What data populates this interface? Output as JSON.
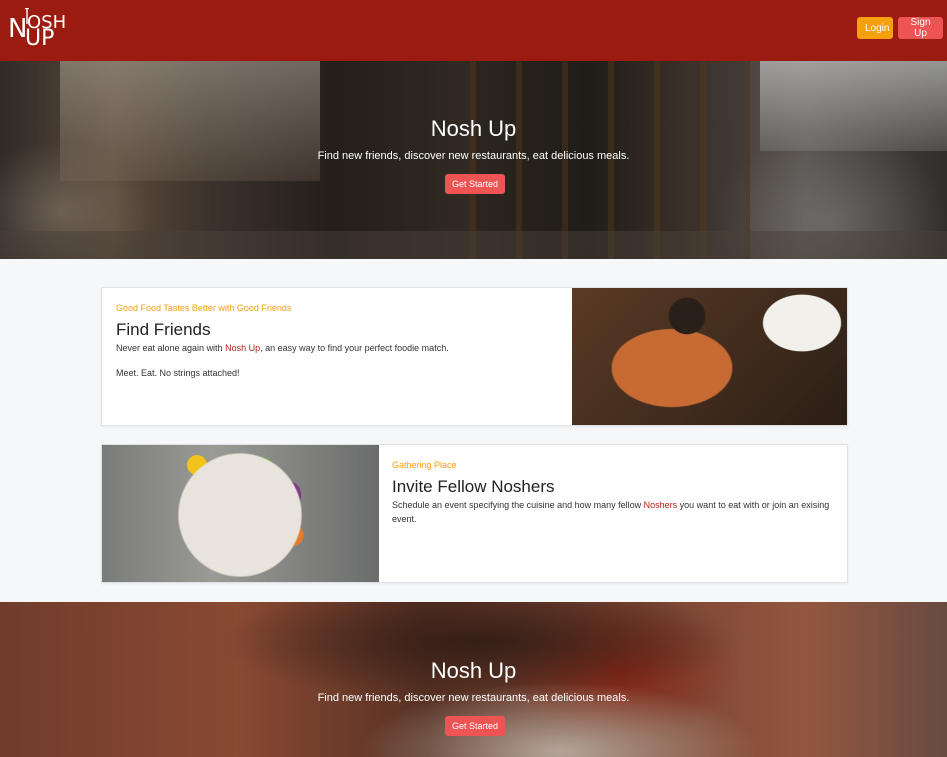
{
  "navbar": {
    "logo": {
      "n": "N",
      "osh": "OSH",
      "up": "UP"
    },
    "login_label": "Login",
    "signup_label": "Sign Up"
  },
  "hero_top": {
    "title": "Nosh Up",
    "subtitle": "Find new friends, discover new restaurants, eat delicious meals.",
    "button_label": "Get Started"
  },
  "feature_find_friends": {
    "eyebrow": "Good Food Tastes Better with Good Friends",
    "title": "Find Friends",
    "body_before": "Never eat alone again with ",
    "body_brand": "Nosh Up",
    "body_after": ", an easy way to find your perfect foodie match.",
    "tagline": "Meet. Eat. No strings attached!"
  },
  "feature_invite": {
    "eyebrow": "Gathering Place",
    "title": "Invite Fellow Noshers",
    "body_before": "Schedule an event specifying the cuisine and how many fellow ",
    "body_brand": "Noshers",
    "body_after": " you want to eat with or join an exising event."
  },
  "hero_bottom": {
    "title": "Nosh Up",
    "subtitle": "Find new friends, discover new restaurants, eat delicious meals.",
    "button_label": "Get Started"
  },
  "colors": {
    "navbar": "#9c1b10",
    "login": "#f5a00f",
    "signup": "#ee5454",
    "accent_text": "#f5a00f",
    "brand_text": "#b5241a"
  }
}
